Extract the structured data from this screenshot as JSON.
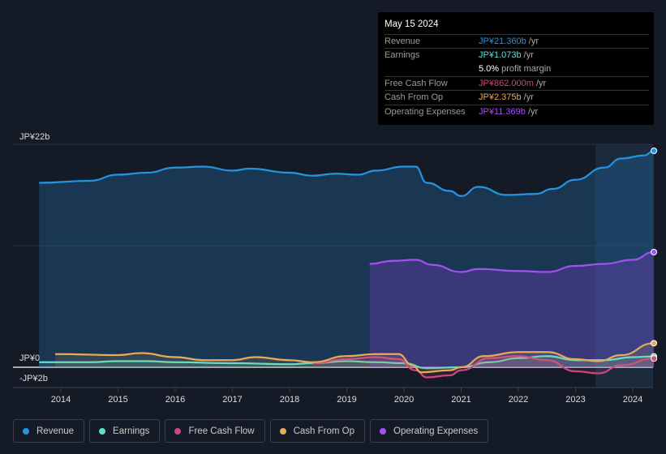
{
  "chart_data": {
    "type": "line",
    "ylim": [
      -2,
      22
    ],
    "xlim": [
      2013.25,
      2024.4
    ],
    "y_tick_labels": [
      "JP¥22b",
      "JP¥0",
      "-JP¥2b"
    ],
    "x_tick_labels": [
      "2014",
      "2015",
      "2016",
      "2017",
      "2018",
      "2019",
      "2020",
      "2021",
      "2022",
      "2023",
      "2024"
    ],
    "forecast_shading_from": 2023.35,
    "grid": "horizontal",
    "legend_placement": "bottom",
    "series": [
      {
        "name": "Revenue",
        "color": "#2394e0",
        "points": [
          [
            2013.62,
            18.2
          ],
          [
            2014.5,
            18.4
          ],
          [
            2015,
            19.0
          ],
          [
            2015.5,
            19.2
          ],
          [
            2016,
            19.7
          ],
          [
            2016.5,
            19.8
          ],
          [
            2017,
            19.4
          ],
          [
            2017.3,
            19.6
          ],
          [
            2018,
            19.2
          ],
          [
            2018.4,
            18.9
          ],
          [
            2018.8,
            19.1
          ],
          [
            2019.2,
            19.0
          ],
          [
            2019.5,
            19.4
          ],
          [
            2020,
            19.8
          ],
          [
            2020.2,
            19.8
          ],
          [
            2020.4,
            18.2
          ],
          [
            2020.8,
            17.4
          ],
          [
            2021,
            16.9
          ],
          [
            2021.3,
            17.8
          ],
          [
            2021.8,
            17.0
          ],
          [
            2022.3,
            17.1
          ],
          [
            2022.6,
            17.6
          ],
          [
            2023,
            18.5
          ],
          [
            2023.5,
            19.7
          ],
          [
            2023.8,
            20.6
          ],
          [
            2024.2,
            20.9
          ],
          [
            2024.37,
            21.36
          ]
        ]
      },
      {
        "name": "Operating Expenses",
        "color": "#a44ff0",
        "points": [
          [
            2019.4,
            10.2
          ],
          [
            2019.8,
            10.5
          ],
          [
            2020.2,
            10.6
          ],
          [
            2020.5,
            10.1
          ],
          [
            2021,
            9.4
          ],
          [
            2021.3,
            9.7
          ],
          [
            2022,
            9.5
          ],
          [
            2022.5,
            9.4
          ],
          [
            2023,
            10.0
          ],
          [
            2023.5,
            10.2
          ],
          [
            2024,
            10.6
          ],
          [
            2024.37,
            11.37
          ]
        ]
      },
      {
        "name": "Earnings",
        "color": "#5ee0cc",
        "points": [
          [
            2013.62,
            0.5
          ],
          [
            2014.5,
            0.5
          ],
          [
            2015,
            0.6
          ],
          [
            2015.5,
            0.6
          ],
          [
            2016,
            0.5
          ],
          [
            2017,
            0.4
          ],
          [
            2018,
            0.3
          ],
          [
            2018.4,
            0.4
          ],
          [
            2019,
            0.6
          ],
          [
            2019.5,
            0.5
          ],
          [
            2020,
            0.4
          ],
          [
            2020.4,
            -0.1
          ],
          [
            2021,
            0.0
          ],
          [
            2021.5,
            0.5
          ],
          [
            2022,
            0.9
          ],
          [
            2022.5,
            1.1
          ],
          [
            2023,
            0.7
          ],
          [
            2023.5,
            0.7
          ],
          [
            2024,
            1.0
          ],
          [
            2024.37,
            1.07
          ]
        ]
      },
      {
        "name": "Free Cash Flow",
        "color": "#d0457f",
        "points": [
          [
            2018.4,
            0.4
          ],
          [
            2019,
            0.8
          ],
          [
            2019.5,
            1.0
          ],
          [
            2019.9,
            0.8
          ],
          [
            2020.2,
            -0.3
          ],
          [
            2020.4,
            -1.0
          ],
          [
            2020.8,
            -0.8
          ],
          [
            2021,
            -0.3
          ],
          [
            2021.5,
            0.9
          ],
          [
            2022,
            1.1
          ],
          [
            2022.5,
            0.7
          ],
          [
            2023,
            -0.4
          ],
          [
            2023.4,
            -0.6
          ],
          [
            2023.8,
            0.2
          ],
          [
            2024.37,
            0.86
          ]
        ]
      },
      {
        "name": "Cash From Op",
        "color": "#e8a95a",
        "points": [
          [
            2013.9,
            1.3
          ],
          [
            2015,
            1.2
          ],
          [
            2015.4,
            1.4
          ],
          [
            2016,
            1.0
          ],
          [
            2016.5,
            0.7
          ],
          [
            2017,
            0.7
          ],
          [
            2017.4,
            1.0
          ],
          [
            2018,
            0.7
          ],
          [
            2018.4,
            0.5
          ],
          [
            2019,
            1.1
          ],
          [
            2019.5,
            1.3
          ],
          [
            2019.9,
            1.3
          ],
          [
            2020.15,
            0.2
          ],
          [
            2020.3,
            -0.5
          ],
          [
            2020.8,
            -0.3
          ],
          [
            2021,
            0.0
          ],
          [
            2021.4,
            1.1
          ],
          [
            2022,
            1.5
          ],
          [
            2022.5,
            1.5
          ],
          [
            2023,
            0.8
          ],
          [
            2023.4,
            0.6
          ],
          [
            2023.8,
            1.2
          ],
          [
            2024.37,
            2.375
          ]
        ]
      }
    ]
  },
  "tooltip": {
    "date": "May 15 2024",
    "rows": [
      {
        "label": "Revenue",
        "value": "JP¥21.360b",
        "unit": " /yr",
        "color": "#2394e0"
      },
      {
        "label": "Earnings",
        "value": "JP¥1.073b",
        "unit": " /yr",
        "color": "#5ee0cc"
      },
      {
        "label": "",
        "value": "5.0%",
        "unit": " profit margin",
        "color": "#ffffff"
      },
      {
        "label": "Free Cash Flow",
        "value": "JP¥862.000m",
        "unit": " /yr",
        "color": "#d0457f"
      },
      {
        "label": "Cash From Op",
        "value": "JP¥2.375b",
        "unit": " /yr",
        "color": "#e8a95a"
      },
      {
        "label": "Operating Expenses",
        "value": "JP¥11.369b",
        "unit": " /yr",
        "color": "#a44ff0"
      }
    ]
  },
  "legend": [
    {
      "label": "Revenue",
      "color": "#2394e0"
    },
    {
      "label": "Earnings",
      "color": "#5ee0cc"
    },
    {
      "label": "Free Cash Flow",
      "color": "#d0457f"
    },
    {
      "label": "Cash From Op",
      "color": "#e8a95a"
    },
    {
      "label": "Operating Expenses",
      "color": "#a44ff0"
    }
  ]
}
